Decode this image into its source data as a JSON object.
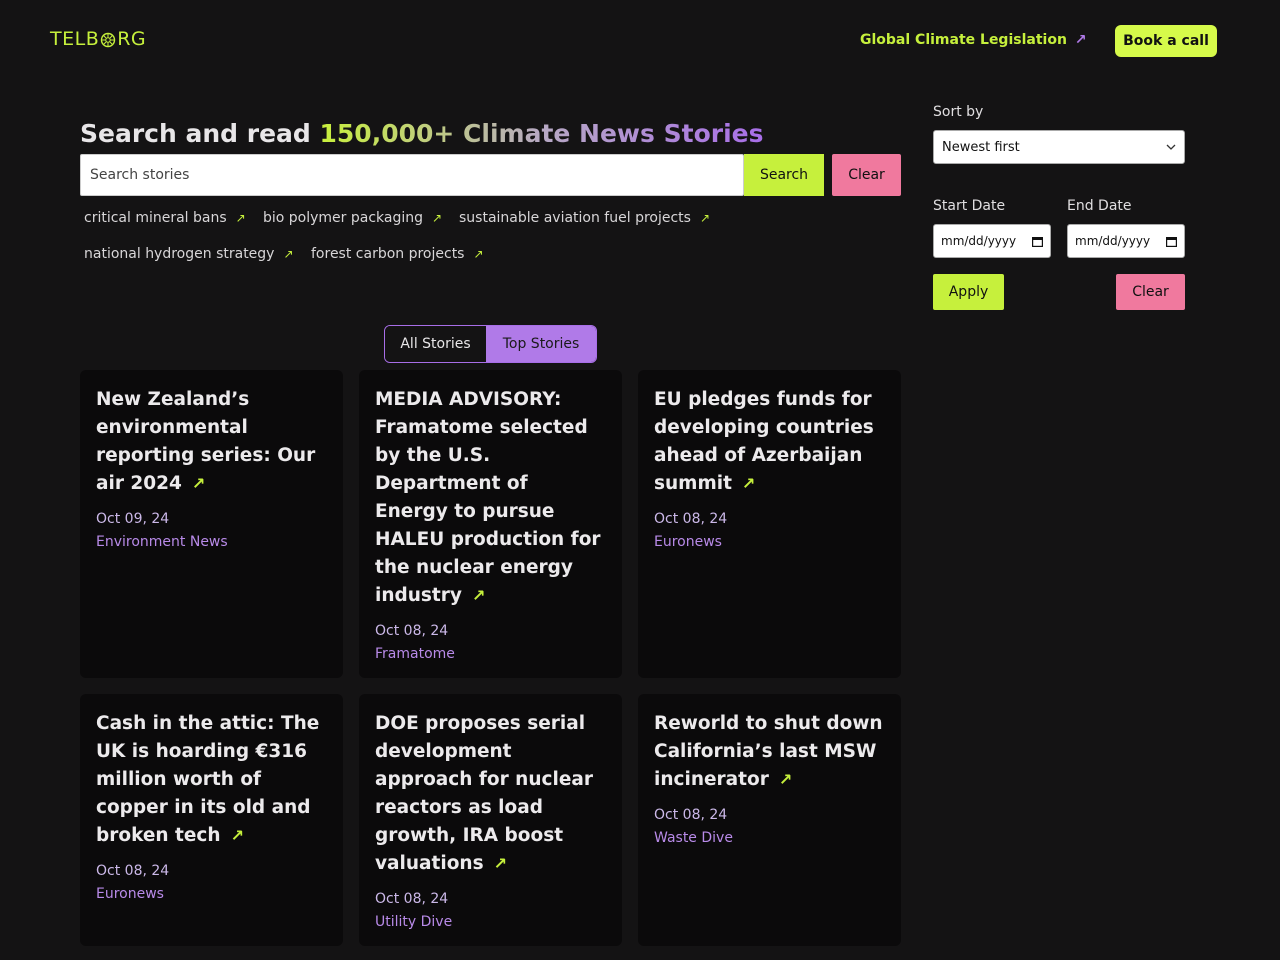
{
  "header": {
    "logo_left": "TELB",
    "logo_right": "RG",
    "nav_link": "Global Climate Legislation",
    "nav_arrow": "↗",
    "book_button": "Book a call"
  },
  "hero": {
    "title_prefix": "Search and read ",
    "title_highlight": "150,000+ Climate News Stories"
  },
  "search": {
    "placeholder": "Search stories",
    "search_button": "Search",
    "clear_button": "Clear"
  },
  "tags": [
    {
      "label": "critical mineral bans"
    },
    {
      "label": "bio polymer packaging"
    },
    {
      "label": "sustainable aviation fuel projects"
    },
    {
      "label": "national hydrogen strategy"
    },
    {
      "label": "forest carbon projects"
    }
  ],
  "tag_arrow": "↗",
  "toggle": {
    "all": "All Stories",
    "top": "Top Stories",
    "active": "Top Stories"
  },
  "stories": [
    {
      "title": "New Zealand’s environmental reporting series: Our air 2024",
      "date": "Oct 09, 24",
      "source": "Environment News"
    },
    {
      "title": "MEDIA ADVISORY: Framatome selected by the U.S. Department of Energy to pursue HALEU production for the nuclear energy industry",
      "date": "Oct 08, 24",
      "source": "Framatome"
    },
    {
      "title": "EU pledges funds for developing countries ahead of Azerbaijan summit",
      "date": "Oct 08, 24",
      "source": "Euronews"
    },
    {
      "title": "Cash in the attic: The UK is hoarding €316 million worth of copper in its old and broken tech",
      "date": "Oct 08, 24",
      "source": "Euronews"
    },
    {
      "title": "DOE proposes serial development approach for nuclear reactors as load growth, IRA boost valuations",
      "date": "Oct 08, 24",
      "source": "Utility Dive"
    },
    {
      "title": "Reworld to shut down California’s last MSW incinerator",
      "date": "Oct 08, 24",
      "source": "Waste Dive"
    }
  ],
  "story_arrow": "↗",
  "sidebar": {
    "sort_label": "Sort by",
    "sort_value": "Newest first",
    "start_label": "Start Date",
    "end_label": "End Date",
    "start_value": "mm/dd/yyyy",
    "end_value": "mm/dd/yyyy",
    "apply_button": "Apply",
    "clear_button": "Clear"
  },
  "colors": {
    "accent_lime": "#c6f03c",
    "accent_purple": "#a86ee8",
    "accent_pink": "#f0799e",
    "background": "#141314",
    "card": "#0b0a0b"
  }
}
